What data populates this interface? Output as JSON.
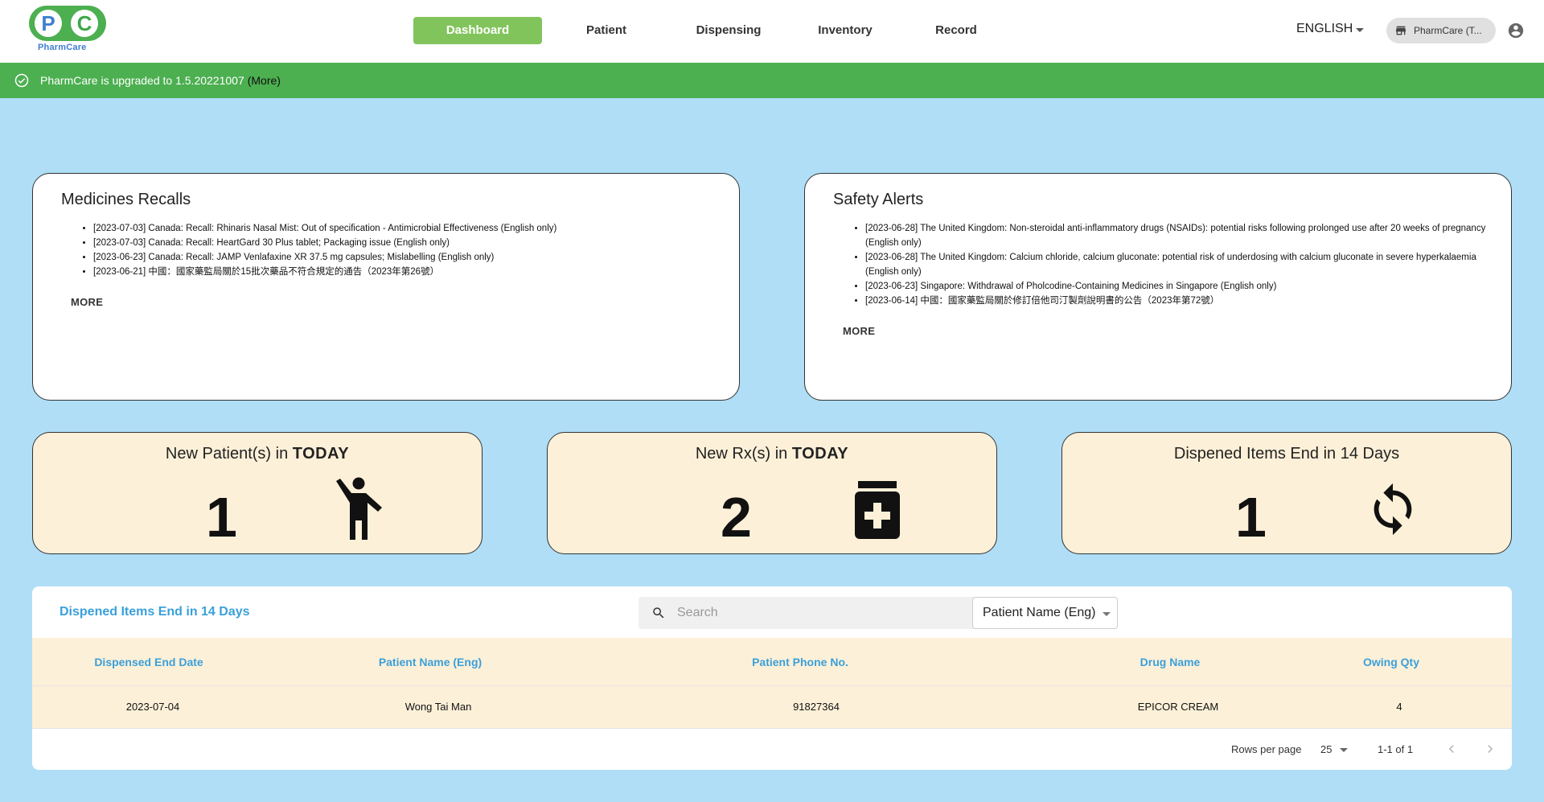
{
  "logo": {
    "left_letter": "P",
    "right_letter": "C",
    "name": "PharmCare"
  },
  "nav": [
    {
      "label": "Dashboard",
      "active": true
    },
    {
      "label": "Patient",
      "active": false
    },
    {
      "label": "Dispensing",
      "active": false
    },
    {
      "label": "Inventory",
      "active": false
    },
    {
      "label": "Record",
      "active": false
    }
  ],
  "header": {
    "language": "ENGLISH",
    "store_label": "PharmCare (T...",
    "icons": {
      "store": "store-icon",
      "account": "account-circle-icon",
      "language": "chevron-down-icon"
    }
  },
  "banner": {
    "text": "PharmCare is upgraded to 1.5.20221007",
    "more": "(More)",
    "icon": "check-circle-icon",
    "color": "#4caf50"
  },
  "recalls": {
    "title": "Medicines Recalls",
    "items": [
      "[2023-07-03] Canada: Recall: Rhinaris Nasal Mist: Out of specification - Antimicrobial Effectiveness (English only)",
      "[2023-07-03] Canada: Recall: HeartGard 30 Plus tablet; Packaging issue (English only)",
      "[2023-06-23] Canada: Recall: JAMP Venlafaxine XR 37.5 mg capsules; Mislabelling (English only)",
      "[2023-06-21] 中國：國家藥監局關於15批次藥品不符合規定的通告（2023年第26號）"
    ],
    "more": "MORE"
  },
  "alerts": {
    "title": "Safety Alerts",
    "items": [
      "[2023-06-28] The United Kingdom: Non-steroidal anti-inflammatory drugs (NSAIDs): potential risks following prolonged use after 20 weeks of pregnancy (English only)",
      "[2023-06-28] The United Kingdom: Calcium chloride, calcium gluconate: potential risk of underdosing with calcium gluconate in severe hyperkalaemia (English only)",
      "[2023-06-23] Singapore: Withdrawal of Pholcodine-Containing Medicines in Singapore (English only)",
      "[2023-06-14] 中國：國家藥監局關於修訂倍他司汀製劑說明書的公告（2023年第72號）"
    ],
    "more": "MORE"
  },
  "stats": {
    "patients": {
      "title_prefix": "New Patient(s) in ",
      "title_bold": "TODAY",
      "value": "1",
      "icon": "person-waving-icon"
    },
    "rx": {
      "title_prefix": "New Rx(s) in ",
      "title_bold": "TODAY",
      "value": "2",
      "icon": "medication-bottle-icon"
    },
    "dispensed": {
      "title_prefix": "Dispened Items End in 14 Days",
      "title_bold": "",
      "value": "1",
      "icon": "refresh-icon"
    }
  },
  "table": {
    "title": "Dispened Items End in 14 Days",
    "search_placeholder": "Search",
    "search_value": "",
    "filter_value": "Patient Name (Eng)",
    "columns": [
      "Dispensed End Date",
      "Patient Name (Eng)",
      "Patient Phone No.",
      "Drug Name",
      "Owing Qty"
    ],
    "rows": [
      [
        "2023-07-04",
        "Wong Tai Man",
        "91827364",
        "EPICOR CREAM",
        "4"
      ]
    ],
    "rows_per_page_label": "Rows per page",
    "rows_per_page": "25",
    "range": "1-1 of 1"
  },
  "colors": {
    "background": "#b0def7",
    "nav_active": "#82c45c",
    "accent_blue": "#3aa0da",
    "stat_bg": "#fdf0d8"
  }
}
